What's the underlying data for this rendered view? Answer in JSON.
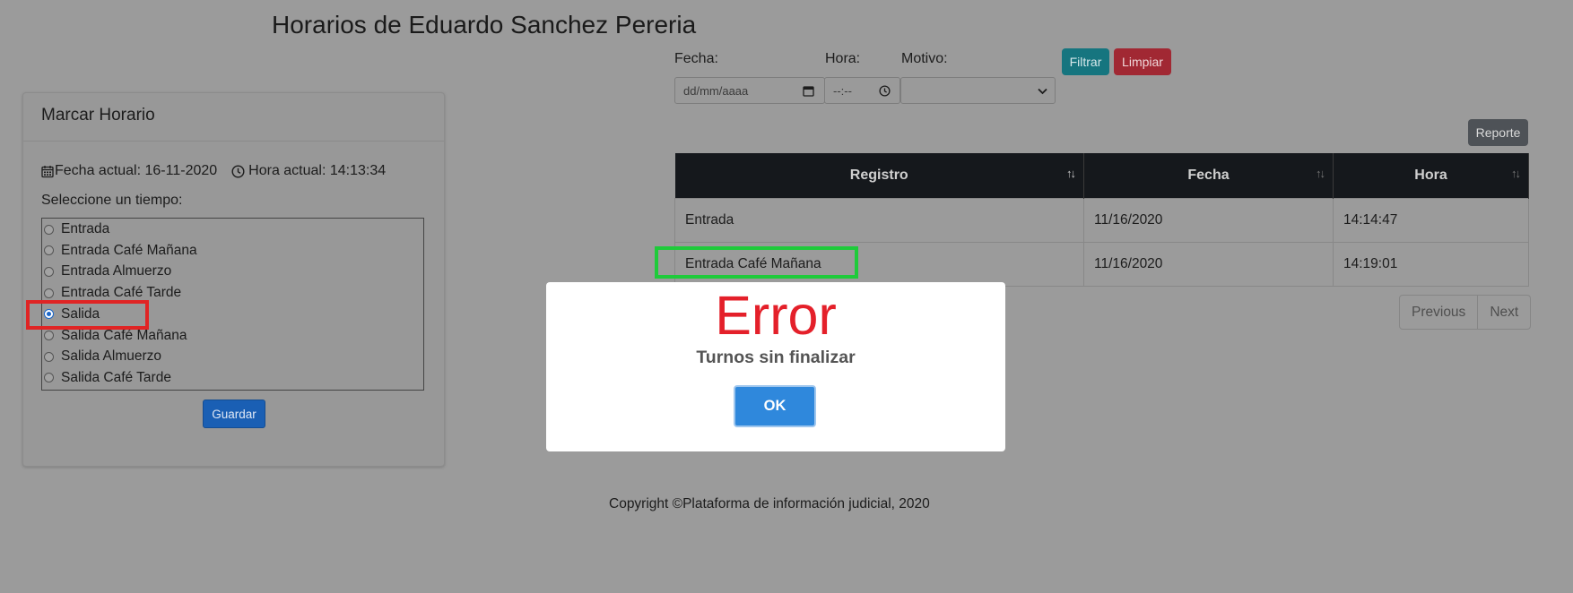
{
  "page": {
    "title": "Horarios de Eduardo Sanchez Pereria"
  },
  "mark_card": {
    "title": "Marcar Horario",
    "fecha_actual": "Fecha actual: 16-11-2020",
    "hora_actual": "Hora actual: 14:13:34",
    "select_label": "Seleccione un tiempo:",
    "options": [
      {
        "label": "Entrada",
        "checked": false
      },
      {
        "label": "Entrada Café Mañana",
        "checked": false
      },
      {
        "label": "Entrada Almuerzo",
        "checked": false
      },
      {
        "label": "Entrada Café Tarde",
        "checked": false
      },
      {
        "label": "Salida",
        "checked": true
      },
      {
        "label": "Salida Café Mañana",
        "checked": false
      },
      {
        "label": "Salida Almuerzo",
        "checked": false
      },
      {
        "label": "Salida Café Tarde",
        "checked": false
      }
    ],
    "save_label": "Guardar"
  },
  "filters": {
    "fecha_label": "Fecha:",
    "fecha_placeholder": "dd/mm/aaaa",
    "hora_label": "Hora:",
    "hora_placeholder": "--:--",
    "motivo_label": "Motivo:",
    "motivo_value": "",
    "filtrar_label": "Filtrar",
    "limpiar_label": "Limpiar"
  },
  "report_label": "Reporte",
  "table": {
    "headers": [
      "Registro",
      "Fecha",
      "Hora"
    ],
    "rows": [
      [
        "Entrada",
        "11/16/2020",
        "14:14:47"
      ],
      [
        "Entrada Café Mañana",
        "11/16/2020",
        "14:19:01"
      ]
    ]
  },
  "pager": {
    "previous": "Previous",
    "next": "Next"
  },
  "footer": {
    "copyright": "Copyright ©Plataforma de información judicial, 2020"
  },
  "modal": {
    "title": "Error",
    "message": "Turnos sin finalizar",
    "ok_label": "OK"
  },
  "colors": {
    "overlay": "#9b9b9b",
    "error": "#e4202a",
    "ok_button": "#2f88dc",
    "highlight_red": "#e02424",
    "highlight_green": "#1ecb3a"
  }
}
